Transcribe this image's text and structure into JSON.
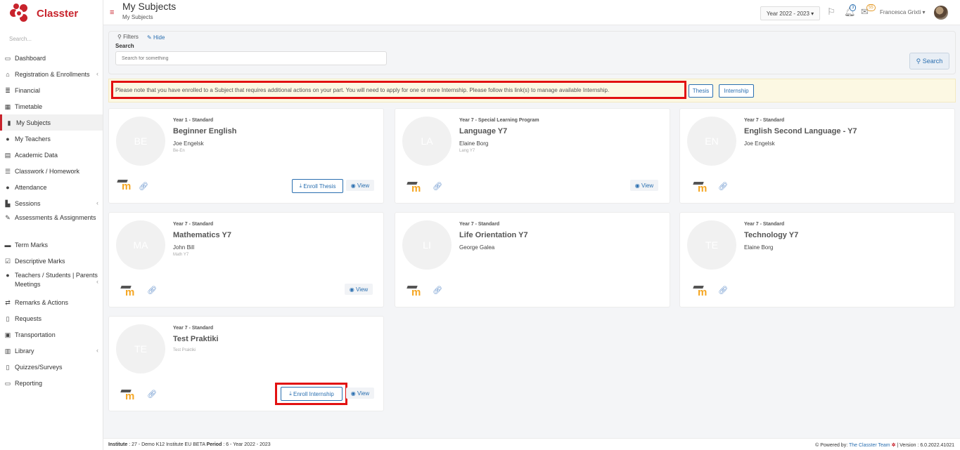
{
  "app": {
    "name": "Classter"
  },
  "sidebar": {
    "search_placeholder": "Search...",
    "items": [
      {
        "label": "Dashboard",
        "icon": "laptop-icon"
      },
      {
        "label": "Registration & Enrollments",
        "icon": "institution-icon",
        "has_children": true
      },
      {
        "label": "Financial",
        "icon": "money-icon"
      },
      {
        "label": "Timetable",
        "icon": "calendar-icon"
      },
      {
        "label": "My Subjects",
        "icon": "book-icon",
        "active": true
      },
      {
        "label": "My Teachers",
        "icon": "users-icon"
      },
      {
        "label": "Academic Data",
        "icon": "id-card-icon"
      },
      {
        "label": "Classwork / Homework",
        "icon": "list-icon"
      },
      {
        "label": "Attendance",
        "icon": "user-times-icon"
      },
      {
        "label": "Sessions",
        "icon": "chart-icon",
        "has_children": true
      },
      {
        "label": "Assessments & Assignments",
        "icon": "edit-icon"
      },
      {
        "label": "Term Marks",
        "icon": "card-icon"
      },
      {
        "label": "Descriptive Marks",
        "icon": "check-square-icon"
      },
      {
        "label": "Teachers / Students | Parents Meetings",
        "icon": "meeting-icon",
        "has_children": true
      },
      {
        "label": "Remarks & Actions",
        "icon": "random-icon"
      },
      {
        "label": "Requests",
        "icon": "file-icon"
      },
      {
        "label": "Transportation",
        "icon": "bus-icon"
      },
      {
        "label": "Library",
        "icon": "library-icon",
        "has_children": true
      },
      {
        "label": "Quizzes/Surveys",
        "icon": "clipboard-icon"
      },
      {
        "label": "Reporting",
        "icon": "print-icon"
      }
    ]
  },
  "header": {
    "title": "My Subjects",
    "breadcrumb": "My Subjects",
    "year_select": "Year 2022 - 2023",
    "notifications_count": "3",
    "messages_count": "55",
    "user_name": "Francesca Grixti"
  },
  "filters": {
    "label": "Filters",
    "hide_label": "Hide",
    "search_label": "Search",
    "search_placeholder": "Search for something",
    "search_button": "Search"
  },
  "notice": {
    "text": "Please note that you have enrolled to a Subject that requires additional actions on your part. You will need to apply for one or more Internship. Please follow this link(s) to manage available Internship.",
    "thesis_button": "Thesis",
    "internship_button": "Internship"
  },
  "subjects": [
    {
      "initials": "BE",
      "meta": "Year 1 - Standard",
      "title": "Beginner English",
      "teacher": "Joe Engelsk",
      "code": "Be-En",
      "enroll_label": "Enroll Thesis",
      "view_label": "View"
    },
    {
      "initials": "LA",
      "meta": "Year 7 - Special Learning Program",
      "title": "Language Y7",
      "teacher": "Elaine Borg",
      "code": "Lang Y7",
      "enroll_label": "",
      "view_label": "View"
    },
    {
      "initials": "EN",
      "meta": "Year 7 - Standard",
      "title": "English Second Language - Y7",
      "teacher": "Joe Engelsk",
      "code": "",
      "enroll_label": "",
      "view_label": ""
    },
    {
      "initials": "MA",
      "meta": "Year 7 - Standard",
      "title": "Mathematics Y7",
      "teacher": "John Bill",
      "code": "Math Y7",
      "enroll_label": "",
      "view_label": "View"
    },
    {
      "initials": "LI",
      "meta": "Year 7 - Standard",
      "title": "Life Orientation Y7",
      "teacher": "George Galea",
      "code": "",
      "enroll_label": "",
      "view_label": ""
    },
    {
      "initials": "TE",
      "meta": "Year 7 - Standard",
      "title": "Technology Y7",
      "teacher": "Elaine Borg",
      "code": "",
      "enroll_label": "",
      "view_label": ""
    },
    {
      "initials": "TE",
      "meta": "Year 7 - Standard",
      "title": "Test Praktiki",
      "teacher": "",
      "code": "Test Praktiki",
      "enroll_label": "Enroll Internship",
      "view_label": "View"
    }
  ],
  "footer": {
    "institute_label": "Institute",
    "institute_value": ": 27 - Demo K12 Institute EU BETA",
    "period_label": "Period",
    "period_value": ": 6 - Year 2022 - 2023",
    "powered_by": "Powered by:",
    "team_link": "The Classter Team",
    "version": "| Version : 6.0.2022.41021"
  }
}
